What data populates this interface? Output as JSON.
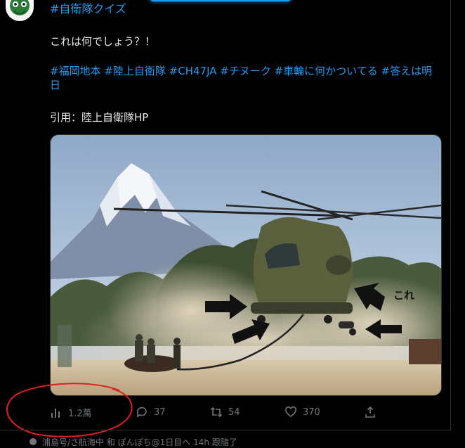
{
  "tweet": {
    "top_hashtag": "#自衛隊クイズ",
    "question": "これは何でしょう？！",
    "hashtags_line": "#福岡地本 #陸上自衛隊 #CH47JA #チヌーク #車輪に何かついてる #答えは明日",
    "quote": "引用：陸上自衛隊HP",
    "image": {
      "annotation_label": "これ"
    }
  },
  "actions": {
    "views": "1.2萬",
    "replies": "37",
    "retweets": "54",
    "likes": "370"
  },
  "next_row": {
    "text": "浦島号/さ航海中 和 ぽんぽち@1日目へ 14h 跟隨了"
  },
  "colors": {
    "accent": "#1d9bf0",
    "background": "#000000",
    "muted": "#71767b",
    "annotation_red": "#e02020"
  },
  "icons": [
    "avatar",
    "views-icon",
    "reply-icon",
    "retweet-icon",
    "like-icon",
    "share-icon",
    "arrow-icon"
  ]
}
